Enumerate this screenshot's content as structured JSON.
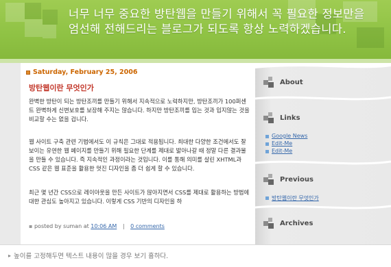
{
  "header": {
    "text": "너무 너무 중요한 방탄웹을 만들기 위해서 꼭 필요한 정보만을 엄선해 전해드리는 블로그가 되도록 항상 노력하겠습니다."
  },
  "post": {
    "date": "Saturday, February 25, 2006",
    "title": "방탄웹이란 무엇인가",
    "paragraphs": [
      "완벽한 방탄이 되는 방탄조끼를 만들기 위해서 지속적으로 노력하지만, 방탄조끼가 100퍼센트 완벽하게 신변보호를 보장해 주지는 않습니다. 하지만 방탄조끼를 입는 것과 입지않는 것을 비교할 수는 없을 겁니다.",
      "웹 사이트 구축 관련 기법에서도 이 규칙은 그대로 적용됩니다. 최대한 다양한 조건에서도 잘 보이는 유연한 웹 페이지를 만들기 위해 필요한 단계를 제대로 밟아나갈 때 정말 다른 결과물을 만들 수 있습니다. 즉 지속적인 과정이라는 것입니다. 이를 통해 의미를 살린 XHTML과 CSS 같은 웹 표준을 활용한 멋진 디자인을 좀 더 쉽게 할 수 있습니다.",
      "최근 몇 년간 CSS으로 레이아웃을 만든 사이트가 많아지면서 CSS를 제대로 활용하는 방법에 대한 관심도 높아지고 있습니다. 이렇게 CSS 기반의 디자인을 하"
    ],
    "footer_prefix": "posted by suman at",
    "time": "10:06 AM",
    "separator": "|",
    "comments": "0 comments"
  },
  "sidebar": {
    "about": "About",
    "links_heading": "Links",
    "links": [
      "Google News",
      "Edit-Me",
      "Edit-Me"
    ],
    "previous_heading": "Previous",
    "previous_link": "방탄웹이란 무엇인가",
    "archives": "Archives"
  },
  "caption": {
    "arrow": "▸",
    "text": "높이를 고정해두면 텍스트 내용이 많을 경우 보기 흉하다."
  },
  "colors": {
    "header_green": "#8fc244",
    "date_orange": "#cc6600",
    "title_red": "#c2372a",
    "link_blue": "#3366aa"
  }
}
